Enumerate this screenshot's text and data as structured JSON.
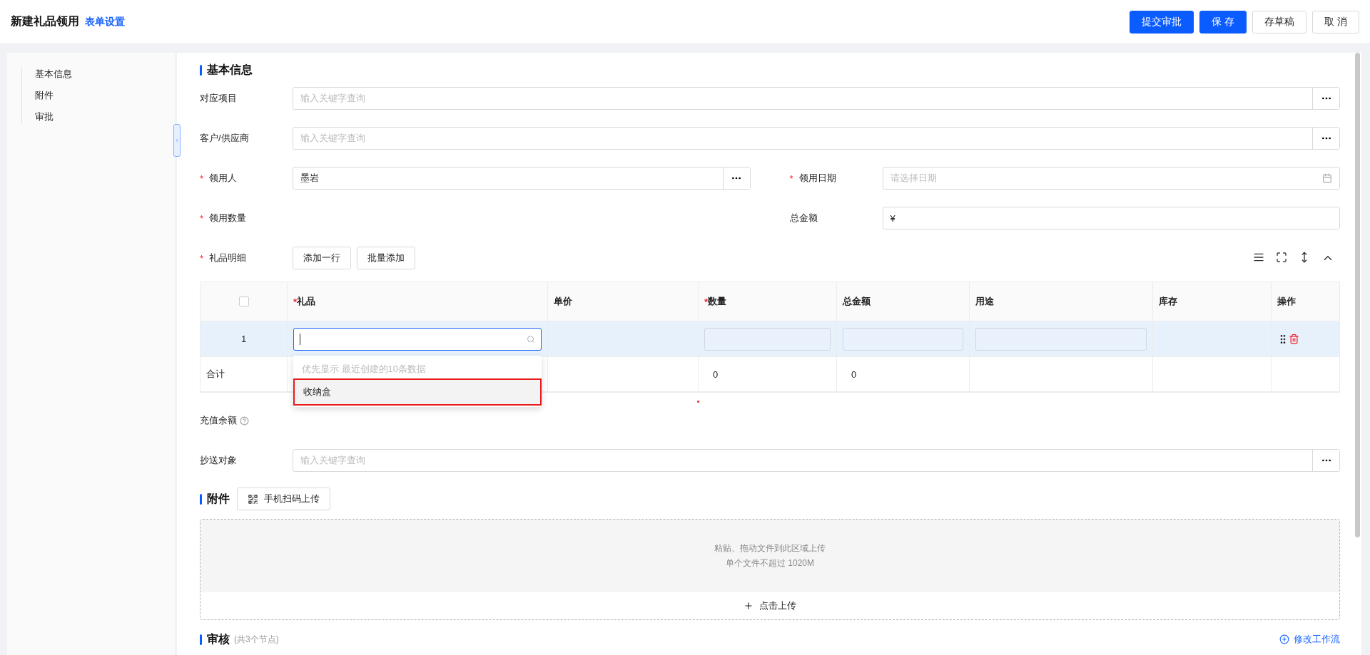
{
  "header": {
    "title": "新建礼品领用",
    "settings_link": "表单设置",
    "buttons": [
      {
        "label": "提交审批",
        "primary": true
      },
      {
        "label": "保 存",
        "primary": true
      },
      {
        "label": "存草稿",
        "primary": false
      },
      {
        "label": "取 消",
        "primary": false
      }
    ]
  },
  "sidebar": {
    "items": [
      {
        "label": "基本信息"
      },
      {
        "label": "附件"
      },
      {
        "label": "审批"
      }
    ]
  },
  "basic": {
    "title": "基本信息",
    "rows": [
      [
        {
          "label": "对应项目",
          "kind": "lookup",
          "placeholder": "输入关键字查询"
        }
      ],
      [
        {
          "label": "客户/供应商",
          "kind": "lookup",
          "placeholder": "输入关键字查询"
        }
      ],
      [
        {
          "label": "领用人",
          "required_mark": "*",
          "kind": "lookup",
          "value": "墨岩"
        },
        {
          "label": "领用日期",
          "required_mark": "*",
          "kind": "date",
          "placeholder": "请选择日期"
        }
      ],
      [
        {
          "label": "领用数量",
          "required_mark": "*",
          "kind": "empty"
        },
        {
          "label": "总金额",
          "kind": "text",
          "value": "¥"
        }
      ]
    ]
  },
  "gift_details": {
    "label": "礼品明细",
    "required_mark": "*",
    "buttons": [
      "添加一行",
      "批量添加"
    ],
    "table": {
      "select_all_checked": false,
      "columns": [
        {
          "label": "礼品",
          "required_mark": "*"
        },
        {
          "label": "单价"
        },
        {
          "label": "数量",
          "required_mark": "*"
        },
        {
          "label": "总金额"
        },
        {
          "label": "用途"
        },
        {
          "label": "库存"
        },
        {
          "label": "操作"
        }
      ],
      "rows": [
        {
          "index": "1",
          "selected": true
        }
      ],
      "totals": {
        "label": "合计",
        "quantity": "0",
        "amount": "0"
      }
    },
    "dropdown": {
      "hint": "优先显示 最近创建的10条数据",
      "options": [
        {
          "label": "收纳盒",
          "highlighted": true
        }
      ]
    }
  },
  "recharge": {
    "label": "充值余额"
  },
  "cc": {
    "label": "抄送对象",
    "placeholder": "输入关键字查询"
  },
  "attachments": {
    "title": "附件",
    "scan_button": "手机扫码上传",
    "drop_lines": [
      "粘贴、拖动文件到此区域上传",
      "单个文件不超过 1020M"
    ],
    "upload_button": "点击上传"
  },
  "review": {
    "title": "审核",
    "note": "(共3个节点)",
    "edit_link": "修改工作流"
  }
}
